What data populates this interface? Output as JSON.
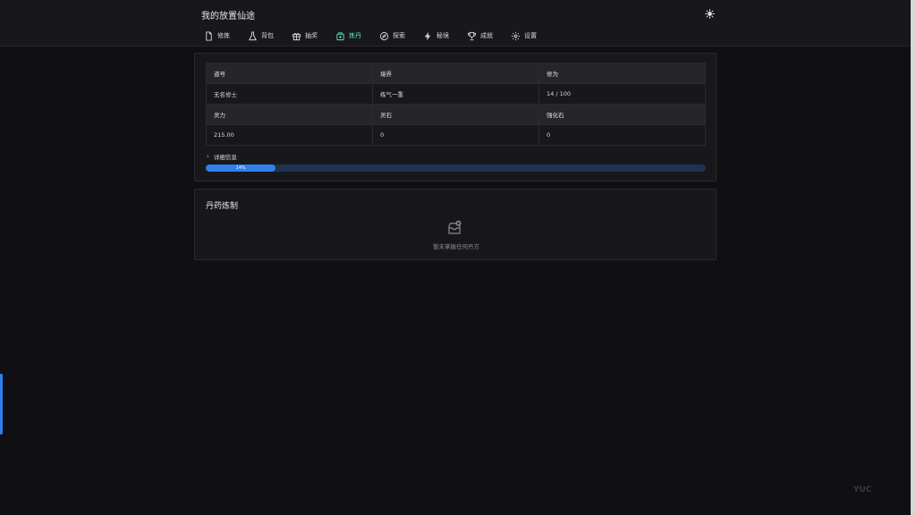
{
  "header": {
    "title": "我的放置仙途",
    "theme_icon": "sun-icon"
  },
  "nav": {
    "items": [
      {
        "label": "修炼",
        "icon": "document-icon",
        "active": false
      },
      {
        "label": "背包",
        "icon": "flask-icon",
        "active": false
      },
      {
        "label": "抽奖",
        "icon": "gift-icon",
        "active": false
      },
      {
        "label": "炼丹",
        "icon": "cauldron-icon",
        "active": true
      },
      {
        "label": "探索",
        "icon": "compass-icon",
        "active": false
      },
      {
        "label": "秘境",
        "icon": "lightning-icon",
        "active": false
      },
      {
        "label": "成就",
        "icon": "trophy-icon",
        "active": false
      },
      {
        "label": "设置",
        "icon": "gear-icon",
        "active": false
      }
    ],
    "active_color": "#63e2b7"
  },
  "status": {
    "row1_headers": [
      "道号",
      "境界",
      "修为"
    ],
    "row1_values": [
      "无名修士",
      "练气一重",
      "14 / 100"
    ],
    "row2_headers": [
      "灵力",
      "灵石",
      "强化石"
    ],
    "row2_values": [
      "215.00",
      "0",
      "0"
    ],
    "details_label": "详细信息",
    "progress_label": "14%",
    "progress_value": 0.14
  },
  "alchemy": {
    "title": "丹药炼制",
    "empty_text": "暂未掌握任何丹方",
    "empty_icon": "empty-box-icon"
  },
  "watermark": "YUC"
}
